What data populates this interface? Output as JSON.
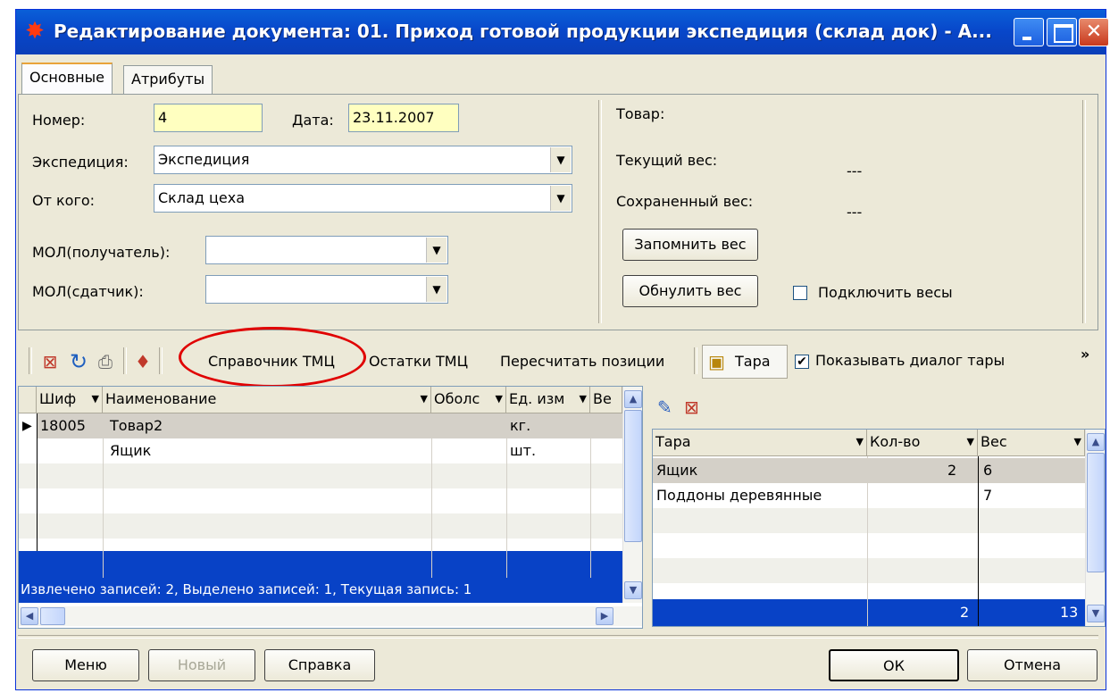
{
  "window": {
    "title": "Редактирование документа: 01. Приход готовой продукции экспедиция (склад док) - А..."
  },
  "tabs": [
    {
      "label": "Основные",
      "active": true
    },
    {
      "label": "Атрибуты",
      "active": false
    }
  ],
  "form": {
    "number_label": "Номер:",
    "number_value": "4",
    "date_label": "Дата:",
    "date_value": "23.11.2007",
    "expedition_label": "Экспедиция:",
    "expedition_value": "Экспедиция",
    "from_label": "От кого:",
    "from_value": "Склад цеха",
    "mol_recv_label": "МОЛ(получатель):",
    "mol_recv_value": "",
    "mol_send_label": "МОЛ(сдатчик):",
    "mol_send_value": ""
  },
  "weight": {
    "goods_label": "Товар:",
    "current_label": "Текущий вес:",
    "current_value": "---",
    "saved_label": "Сохраненный вес:",
    "saved_value": "---",
    "remember_button": "Запомнить вес",
    "reset_button": "Обнулить вес",
    "connect_scales_label": "Подключить весы",
    "connect_scales_checked": false
  },
  "toolbar": {
    "catalog": "Справочник ТМЦ",
    "balances": "Остатки ТМЦ",
    "recalc": "Пересчитать позиции",
    "tare": "Тара",
    "show_tare_dialog": "Показывать диалог тары",
    "show_tare_dialog_checked": true,
    "overflow": "»"
  },
  "goods_grid": {
    "columns": [
      "Шиф",
      "Наименование",
      "Оболс",
      "Ед. изм",
      "Ве"
    ],
    "rows": [
      {
        "code": "18005",
        "name": "Товар2",
        "unit": "кг."
      },
      {
        "code": "",
        "name": "Ящик",
        "unit": "шт."
      }
    ],
    "status": "Извлечено записей: 2, Выделено записей: 1, Текущая запись: 1"
  },
  "tare_grid": {
    "columns": [
      "Тара",
      "Кол-во",
      "Вес"
    ],
    "rows": [
      {
        "name": "Ящик",
        "qty": "2",
        "weight": "6"
      },
      {
        "name": "Поддоны деревянные",
        "qty": "",
        "weight": "7"
      }
    ],
    "totals": {
      "qty": "2",
      "weight": "13"
    }
  },
  "footer": {
    "menu": "Меню",
    "new": "Новый",
    "help": "Справка",
    "ok": "ОК",
    "cancel": "Отмена"
  },
  "colors": {
    "selection": "#0842c6",
    "highlight_circle": "#e00000",
    "required_field": "#ffffc0"
  }
}
